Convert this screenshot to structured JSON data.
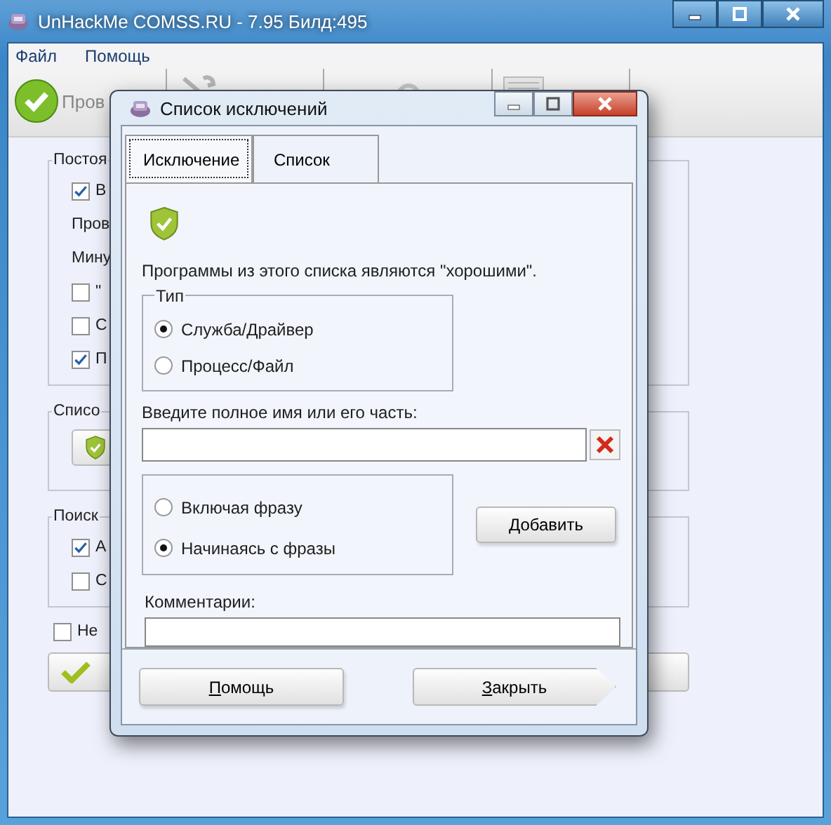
{
  "window": {
    "title": "UnHackMe COMSS.RU - 7.95 Билд:495"
  },
  "menu": [
    "Файл",
    "Помощь"
  ],
  "toolbar": [
    {
      "kind": "check",
      "label": "Пров"
    },
    {
      "kind": "wrench"
    },
    {
      "kind": "lock"
    },
    {
      "kind": "list"
    }
  ],
  "groups": [
    {
      "title": "Постоя",
      "rows": [
        {
          "kind": "checkbox",
          "label": "В",
          "checked": true
        },
        {
          "kind": "text",
          "label": "Пров"
        },
        {
          "kind": "text",
          "label": "Мину"
        },
        {
          "kind": "checkbox",
          "label": "\"",
          "checked": false
        },
        {
          "kind": "checkbox",
          "label": "С",
          "checked": false
        },
        {
          "kind": "checkbox",
          "label": "П",
          "checked": true
        }
      ]
    },
    {
      "title": "Списо",
      "rows": [
        {
          "kind": "button"
        }
      ]
    },
    {
      "title": "Поиск",
      "rows": [
        {
          "kind": "checkbox",
          "label": "А",
          "checked": true
        },
        {
          "kind": "checkbox",
          "label": "С",
          "checked": false
        }
      ]
    }
  ],
  "option": {
    "label": "Не",
    "checked": false
  },
  "bottom_button": {
    "kind": "check"
  },
  "dialog": {
    "title": "Список исключений",
    "tabs": [
      {
        "label": "Исключение",
        "selected": true
      },
      {
        "label": "Список",
        "selected": false
      }
    ],
    "description": "Программы из этого списка являются \"хорошими\".",
    "type_group": {
      "title": "Тип",
      "options": [
        {
          "label": "Служба/Драйвер",
          "selected": true
        },
        {
          "label": "Процесс/Файл",
          "selected": false
        }
      ]
    },
    "name_label": "Введите полное имя или его часть:",
    "match_options": [
      {
        "label": "Включая фразу",
        "selected": false
      },
      {
        "label": "Начинаясь с фразы",
        "selected": true
      }
    ],
    "add_button": "Добавить",
    "comment_label": "Комментарии:",
    "buttons": [
      {
        "kind": "plain",
        "label": "Помощь"
      },
      {
        "kind": "arrow",
        "label": "Закрыть"
      }
    ]
  }
}
